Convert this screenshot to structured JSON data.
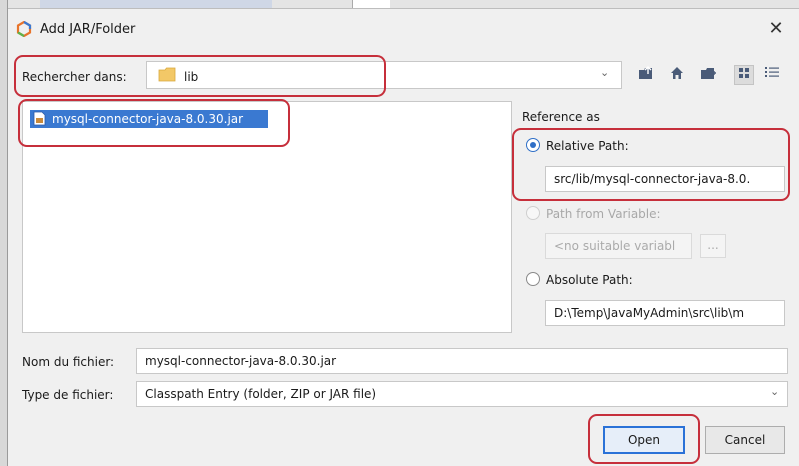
{
  "dialog": {
    "title": "Add JAR/Folder",
    "close_symbol": "✕"
  },
  "lookin": {
    "label": "Rechercher dans:",
    "value": "lib",
    "toolbar_icons": [
      "up-folder-icon",
      "home-icon",
      "new-folder-icon",
      "list-view-icon",
      "details-view-icon"
    ]
  },
  "files": [
    {
      "name": "mysql-connector-java-8.0.30.jar",
      "selected": true
    }
  ],
  "reference": {
    "label": "Reference as",
    "relative_label": "Relative Path:",
    "relative_value": "src/lib/mysql-connector-java-8.0.",
    "variable_label": "Path from Variable:",
    "variable_value": "<no suitable variabl",
    "variable_button": "...",
    "absolute_label": "Absolute Path:",
    "absolute_value": "D:\\Temp\\JavaMyAdmin\\src\\lib\\m",
    "selected": "relative"
  },
  "filename": {
    "label": "Nom du fichier:",
    "value": "mysql-connector-java-8.0.30.jar"
  },
  "filetype": {
    "label": "Type de fichier:",
    "value": "Classpath Entry (folder, ZIP or JAR file)"
  },
  "buttons": {
    "open": "Open",
    "cancel": "Cancel"
  },
  "colors": {
    "selection": "#3a79d1",
    "highlight": "#c62f3b",
    "radio_accent": "#2f6fc7"
  }
}
